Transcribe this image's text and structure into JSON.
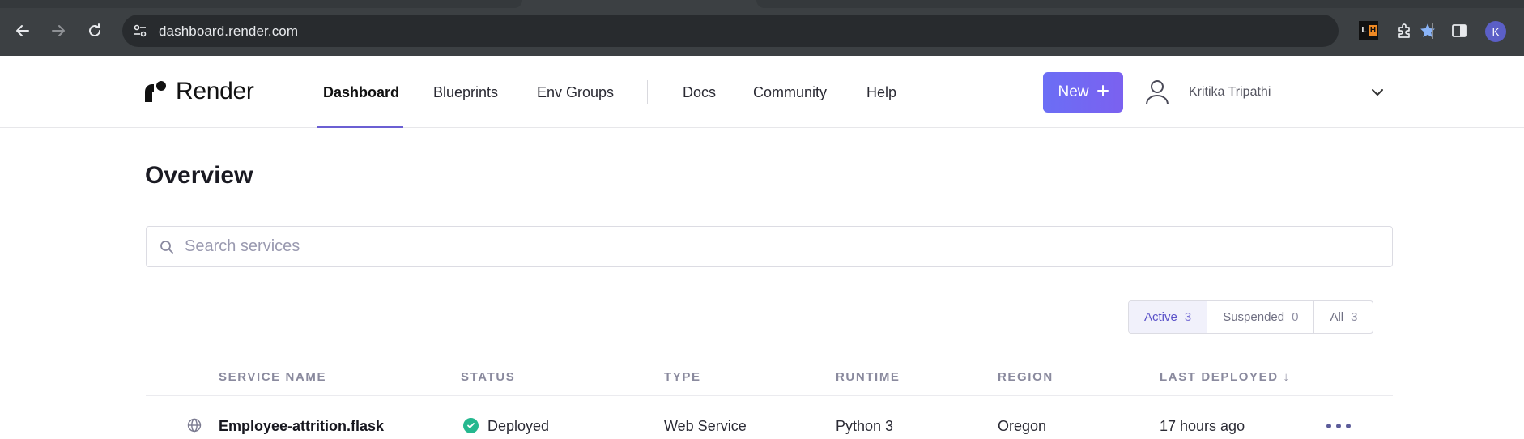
{
  "browser": {
    "url": "dashboard.render.com",
    "profile_initial": "K",
    "ext_lh_left": "L",
    "ext_lh_right": "H"
  },
  "header": {
    "logo_text": "Render",
    "nav": [
      "Dashboard",
      "Blueprints",
      "Env Groups",
      "Docs",
      "Community",
      "Help"
    ],
    "active_nav": "Dashboard",
    "new_label": "New",
    "user_name": "Kritika Tripathi"
  },
  "main": {
    "title": "Overview",
    "search_placeholder": "Search services",
    "filters": [
      {
        "label": "Active",
        "count": "3"
      },
      {
        "label": "Suspended",
        "count": "0"
      },
      {
        "label": "All",
        "count": "3"
      }
    ],
    "columns": [
      "SERVICE NAME",
      "STATUS",
      "TYPE",
      "RUNTIME",
      "REGION",
      "LAST DEPLOYED ↓"
    ],
    "rows": [
      {
        "name": "Employee-attrition.flask",
        "status": "Deployed",
        "type": "Web Service",
        "runtime": "Python 3",
        "region": "Oregon",
        "last_deployed": "17 hours ago"
      }
    ]
  },
  "colors": {
    "accent": "#6b6ef5",
    "status_deployed": "#25b88f",
    "chrome_bg": "#3c4043",
    "star": "#8ab4f8"
  }
}
